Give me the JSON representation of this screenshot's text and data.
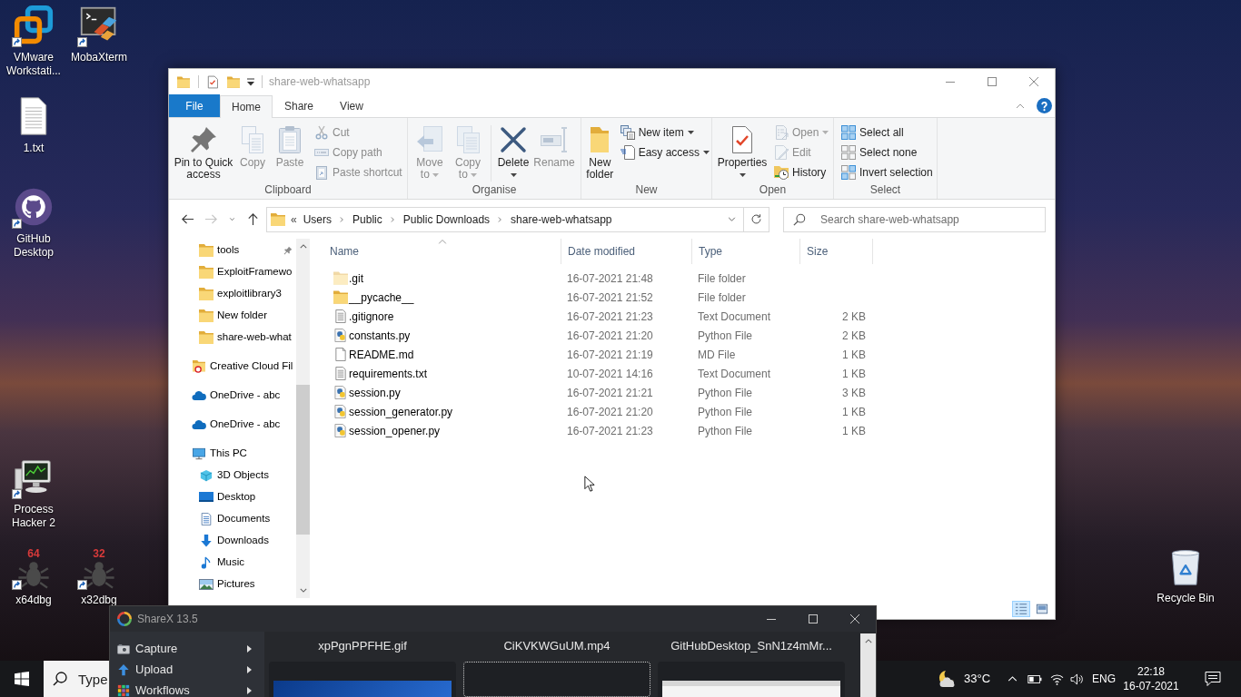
{
  "desktop": {
    "icons": [
      {
        "label": "VMware Workstati...",
        "kind": "vmware",
        "shortcut": true
      },
      {
        "label": "MobaXterm",
        "kind": "terminal",
        "shortcut": true
      },
      {
        "label": "1.txt",
        "kind": "text",
        "shortcut": false
      },
      {
        "label": "GitHub Desktop",
        "kind": "github",
        "shortcut": true
      },
      {
        "label": "Process Hacker 2",
        "kind": "monitor",
        "shortcut": true
      },
      {
        "label": "x64dbg",
        "kind": "bug",
        "badge": "64",
        "shortcut": true
      },
      {
        "label": "x32dbg",
        "kind": "bug",
        "badge": "32",
        "shortcut": true
      },
      {
        "label": "Recycle Bin",
        "kind": "recycle-bin",
        "shortcut": false
      }
    ]
  },
  "explorer": {
    "title": "share-web-whatsapp",
    "tabs": [
      {
        "label": "File",
        "kind": "menu",
        "selected": false
      },
      {
        "label": "Home",
        "kind": "tab",
        "selected": true
      },
      {
        "label": "Share",
        "kind": "tab",
        "selected": false
      },
      {
        "label": "View",
        "kind": "tab",
        "selected": false
      }
    ],
    "ribbon": {
      "groups": [
        {
          "label": "Clipboard",
          "large": [
            {
              "label": "Pin to Quick access",
              "kind": "pin",
              "disabled": false,
              "dropdown": false
            },
            {
              "label": "Copy",
              "kind": "copy",
              "disabled": true,
              "dropdown": false
            },
            {
              "label": "Paste",
              "kind": "paste",
              "disabled": true,
              "dropdown": false
            }
          ],
          "small": [
            {
              "label": "Cut",
              "kind": "cut",
              "disabled": true,
              "dropdown": false
            },
            {
              "label": "Copy path",
              "kind": "copy-path",
              "disabled": true,
              "dropdown": false
            },
            {
              "label": "Paste shortcut",
              "kind": "paste-shortcut",
              "disabled": true,
              "dropdown": false
            }
          ]
        },
        {
          "label": "Organise",
          "large": [
            {
              "label": "Move to",
              "kind": "move",
              "disabled": true,
              "dropdown": true
            },
            {
              "label": "Copy to",
              "kind": "copy-to",
              "disabled": true,
              "dropdown": true
            },
            {
              "kind": "separator"
            },
            {
              "label": "Delete",
              "kind": "delete",
              "disabled": false,
              "dropdown": true
            },
            {
              "label": "Rename",
              "kind": "rename",
              "disabled": true,
              "dropdown": false
            }
          ]
        },
        {
          "label": "New",
          "large": [
            {
              "label": "New folder",
              "kind": "new-folder",
              "disabled": false,
              "dropdown": false
            }
          ],
          "small": [
            {
              "label": "New item",
              "kind": "new-item",
              "disabled": false,
              "dropdown": true
            },
            {
              "label": "Easy access",
              "kind": "easy-access",
              "disabled": false,
              "dropdown": true
            }
          ]
        },
        {
          "label": "Open",
          "large": [
            {
              "label": "Properties",
              "kind": "properties",
              "disabled": false,
              "dropdown": true
            }
          ],
          "small": [
            {
              "label": "Open",
              "kind": "open",
              "disabled": true,
              "dropdown": true
            },
            {
              "label": "Edit",
              "kind": "edit",
              "disabled": true,
              "dropdown": false
            },
            {
              "label": "History",
              "kind": "history",
              "disabled": false,
              "dropdown": false
            }
          ]
        },
        {
          "label": "Select",
          "small": [
            {
              "label": "Select all",
              "kind": "select-all",
              "disabled": false,
              "dropdown": false
            },
            {
              "label": "Select none",
              "kind": "select-none",
              "disabled": false,
              "dropdown": false
            },
            {
              "label": "Invert selection",
              "kind": "invert",
              "disabled": false,
              "dropdown": false
            }
          ]
        }
      ]
    },
    "navigation": [
      {
        "kind": "back",
        "disabled": false
      },
      {
        "kind": "forward",
        "disabled": true
      },
      {
        "kind": "recent",
        "disabled": false
      },
      {
        "kind": "up",
        "disabled": false
      }
    ],
    "address_bar": {
      "overflow": "«",
      "path": [
        "Users",
        "Public",
        "Public Downloads",
        "share-web-whatsapp"
      ]
    },
    "search": {
      "placeholder": "Search share-web-whatsapp"
    },
    "nav_pane": {
      "quick_access": [
        {
          "label": "tools",
          "pinned": true
        },
        {
          "label": "ExploitFramewo",
          "pinned": false
        },
        {
          "label": "exploitlibrary3",
          "pinned": false
        },
        {
          "label": "New folder",
          "pinned": false
        },
        {
          "label": "share-web-what",
          "pinned": false
        }
      ],
      "items": [
        {
          "label": "Creative Cloud Fil",
          "kind": "creative-cloud"
        },
        {
          "label": "OneDrive - abc",
          "kind": "onedrive"
        },
        {
          "label": "OneDrive - abc",
          "kind": "onedrive"
        },
        {
          "label": "This PC",
          "kind": "pc",
          "children": [
            {
              "label": "3D Objects",
              "kind": "objects"
            },
            {
              "label": "Desktop",
              "kind": "desktop"
            },
            {
              "label": "Documents",
              "kind": "documents"
            },
            {
              "label": "Downloads",
              "kind": "downloads"
            },
            {
              "label": "Music",
              "kind": "music"
            },
            {
              "label": "Pictures",
              "kind": "pictures"
            }
          ]
        }
      ]
    },
    "file_list": {
      "columns": [
        {
          "label": "Name",
          "sorted": true
        },
        {
          "label": "Date modified",
          "sorted": false
        },
        {
          "label": "Type",
          "sorted": false
        },
        {
          "label": "Size",
          "sorted": false
        }
      ],
      "rows": [
        {
          "name": ".git",
          "kind": "folder",
          "hidden": true,
          "date": "16-07-2021 21:48",
          "type": "File folder"
        },
        {
          "name": "__pycache__",
          "kind": "folder",
          "hidden": false,
          "date": "16-07-2021 21:52",
          "type": "File folder"
        },
        {
          "name": ".gitignore",
          "kind": "text",
          "hidden": false,
          "date": "16-07-2021 21:23",
          "type": "Text Document",
          "size": "2 KB"
        },
        {
          "name": "constants.py",
          "kind": "python",
          "hidden": false,
          "date": "16-07-2021 21:20",
          "type": "Python File",
          "size": "2 KB"
        },
        {
          "name": "README.md",
          "kind": "markdown",
          "hidden": false,
          "date": "16-07-2021 21:19",
          "type": "MD File",
          "size": "1 KB"
        },
        {
          "name": "requirements.txt",
          "kind": "text",
          "hidden": false,
          "date": "10-07-2021 14:16",
          "type": "Text Document",
          "size": "1 KB"
        },
        {
          "name": "session.py",
          "kind": "python",
          "hidden": false,
          "date": "16-07-2021 21:21",
          "type": "Python File",
          "size": "3 KB"
        },
        {
          "name": "session_generator.py",
          "kind": "python",
          "hidden": false,
          "date": "16-07-2021 21:20",
          "type": "Python File",
          "size": "1 KB"
        },
        {
          "name": "session_opener.py",
          "kind": "python",
          "hidden": false,
          "date": "16-07-2021 21:23",
          "type": "Python File",
          "size": "1 KB"
        }
      ]
    },
    "status_bar": {
      "views": [
        {
          "kind": "details",
          "selected": true
        },
        {
          "kind": "large-icons",
          "selected": false
        }
      ]
    }
  },
  "sharex": {
    "title": "ShareX 13.5",
    "menu": [
      {
        "label": "Capture",
        "kind": "capture"
      },
      {
        "label": "Upload",
        "kind": "upload"
      },
      {
        "label": "Workflows",
        "kind": "workflows"
      }
    ],
    "thumbnails": [
      {
        "title": "xpPgnPPFHE.gif",
        "kind": "screenshot",
        "selected": false
      },
      {
        "title": "CiKVKWGuUM.mp4",
        "kind": "video",
        "selected": true
      },
      {
        "title": "GitHubDesktop_SnN1z4mMr...",
        "kind": "window",
        "selected": false
      }
    ]
  },
  "taskbar": {
    "search": {
      "placeholder": "Type"
    },
    "temperature": "33°C",
    "language": "ENG",
    "time": "22:18",
    "date": "16-07-2021"
  }
}
